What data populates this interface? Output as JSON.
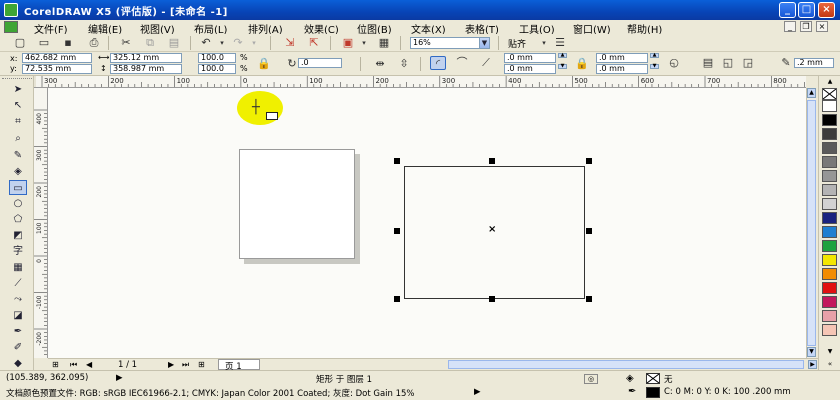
{
  "window": {
    "title": "CorelDRAW X5 (评估版) - [未命名 -1]",
    "buttons": {
      "minimize": "_",
      "maximize": "□",
      "close": "×"
    }
  },
  "menu": {
    "items": [
      "文件(F)",
      "编辑(E)",
      "视图(V)",
      "布局(L)",
      "排列(A)",
      "效果(C)",
      "位图(B)",
      "文本(X)",
      "表格(T)",
      "工具(O)",
      "窗口(W)",
      "帮助(H)"
    ]
  },
  "toolbar1": {
    "zoom": "16%",
    "snap_label": "贴齐"
  },
  "propbar": {
    "x_label": "x:",
    "x_value": "462.682 mm",
    "y_label": "y:",
    "y_value": "72.535 mm",
    "width_value": "325.12 mm",
    "height_value": "358.987 mm",
    "scale_w": "100.0",
    "scale_h": "100.0",
    "percent": "%",
    "rotation": ".0",
    "corner1": ".0 mm",
    "corner2": ".0 mm",
    "corner3": ".0 mm",
    "corner4": ".0 mm",
    "outline_width": ".2 mm"
  },
  "ruler": {
    "h_labels": [
      "300",
      "200",
      "100",
      "0",
      "100",
      "200",
      "300",
      "400",
      "500",
      "600",
      "700",
      "800",
      "900"
    ],
    "v_labels": [
      "400",
      "300",
      "200",
      "100",
      "0",
      "-100",
      "-200"
    ]
  },
  "canvas": {
    "center_mark": "×"
  },
  "pagenav": {
    "counter": "1 / 1",
    "page_tab": "页 1"
  },
  "status": {
    "coords": "(105.389, 362.095)",
    "object_info": "矩形 于 图层 1",
    "color_profile": "文档颜色预置文件: RGB: sRGB IEC61966-2.1; CMYK: Japan Color 2001 Coated; 灰度: Dot Gain 15%",
    "fill_label": "无",
    "outline_info": "C: 0 M: 0 Y: 0 K: 100  .200 mm"
  },
  "palette_colors": [
    "#ffffff",
    "#000000",
    "#3c3c3c",
    "#5a5a5a",
    "#787878",
    "#969696",
    "#b4b4b4",
    "#d2d2d2",
    "#1a237e",
    "#1f7fd0",
    "#1fa23f",
    "#f2e600",
    "#f28c00",
    "#e01010",
    "#c2185b",
    "#e8a0a8",
    "#f5c5b5"
  ]
}
